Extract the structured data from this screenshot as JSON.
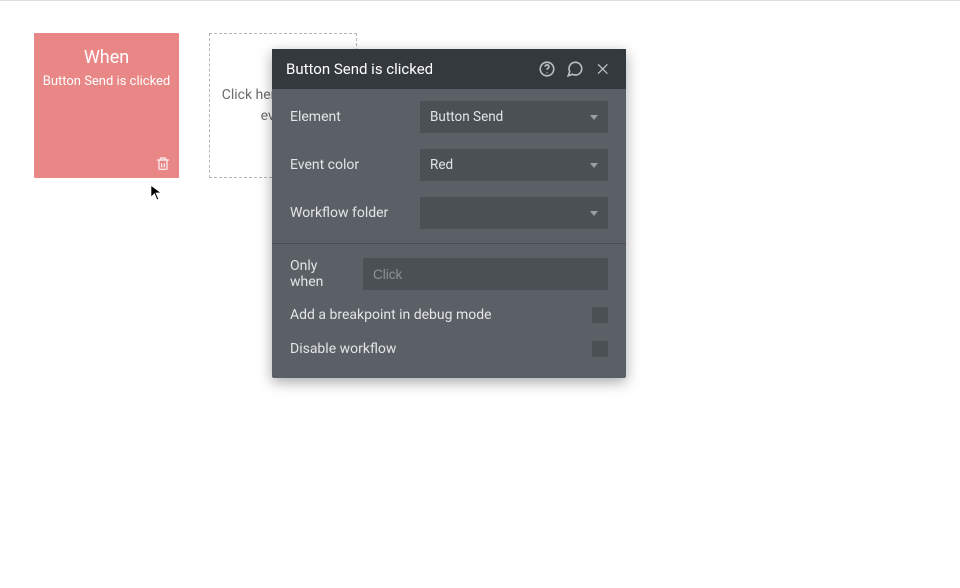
{
  "card": {
    "title": "When",
    "subtitle": "Button Send is clicked"
  },
  "add_box": {
    "text": "Click here to add an event..."
  },
  "panel": {
    "title": "Button Send is clicked",
    "rows": {
      "element": {
        "label": "Element",
        "value": "Button Send"
      },
      "event_color": {
        "label": "Event color",
        "value": "Red"
      },
      "workflow_folder": {
        "label": "Workflow folder",
        "value": ""
      }
    },
    "only_when": {
      "label": "Only when",
      "placeholder": "Click"
    },
    "breakpoint": {
      "label": "Add a breakpoint in debug mode"
    },
    "disable": {
      "label": "Disable workflow"
    }
  }
}
